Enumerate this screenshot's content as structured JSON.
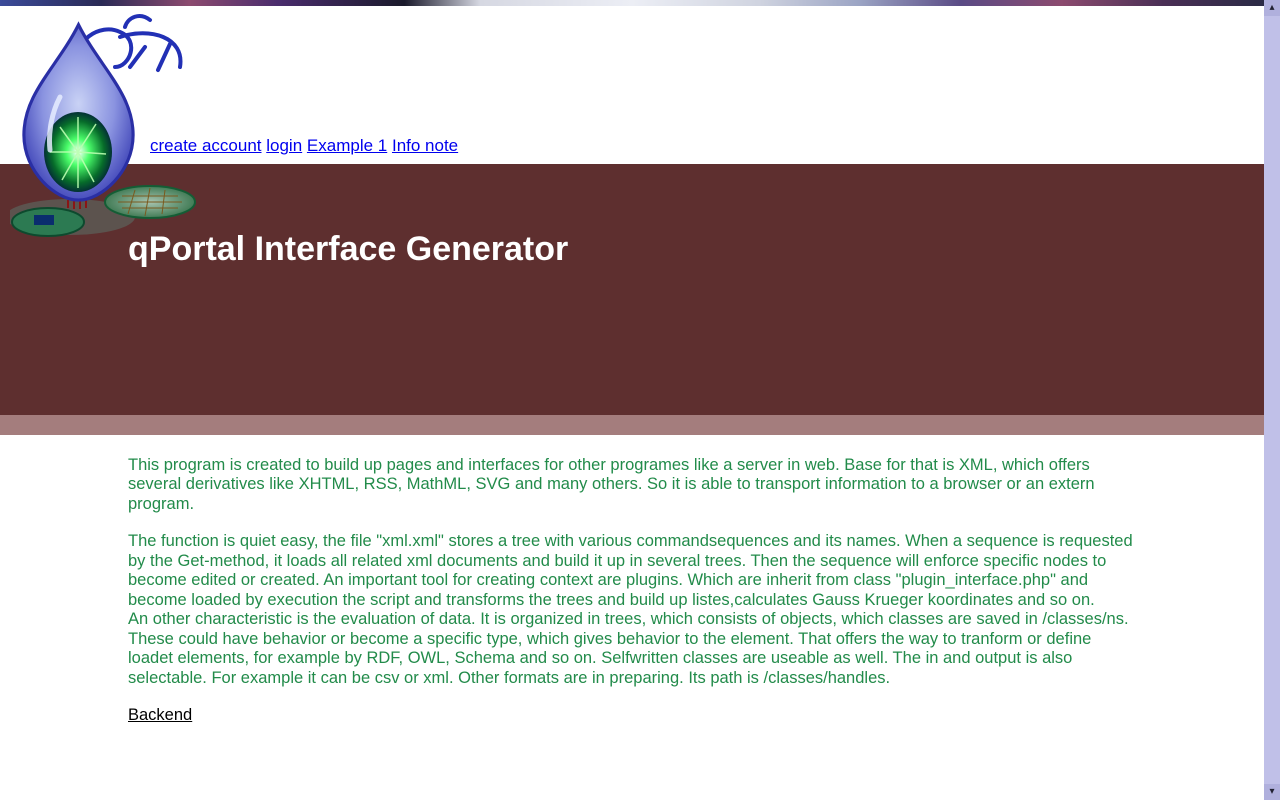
{
  "nav": {
    "create_account": "create account",
    "login": "login",
    "example1": "Example 1",
    "info_note": "Info note"
  },
  "hero": {
    "title": "qPortal Interface Generator"
  },
  "body": {
    "p1": "This program is created to build up pages and interfaces for other programes like a server in web. Base for that is XML, which offers several derivatives like XHTML, RSS, MathML, SVG and many others. So it is able to transport information to a browser or an extern program.",
    "p2": "The function is quiet easy, the file \"xml.xml\" stores a tree with various commandsequences and its names. When a sequence is requested by the Get-method, it loads all related xml documents and build it up in several trees. Then the sequence will enforce specific nodes to become edited or created. An important tool for creating context are plugins. Which are inherit from class \"plugin_interface.php\" and become loaded by execution the script and transforms the trees and build up listes,calculates Gauss Krueger koordinates and so on.\nAn other characteristic is the evaluation of data. It is organized in trees, which consists of objects, which classes are saved in /classes/ns. These could have behavior or become a specific type, which gives behavior to the element. That offers the way to tranform or define loadet elements, for example by RDF, OWL, Schema and so on. Selfwritten classes are useable as well. The in and output is also selectable. For example it can be csv or xml. Other formats are in preparing. Its path is /classes/handles."
  },
  "links": {
    "backend": "Backend"
  },
  "scrollbar": {
    "up": "▴",
    "down": "▾"
  }
}
